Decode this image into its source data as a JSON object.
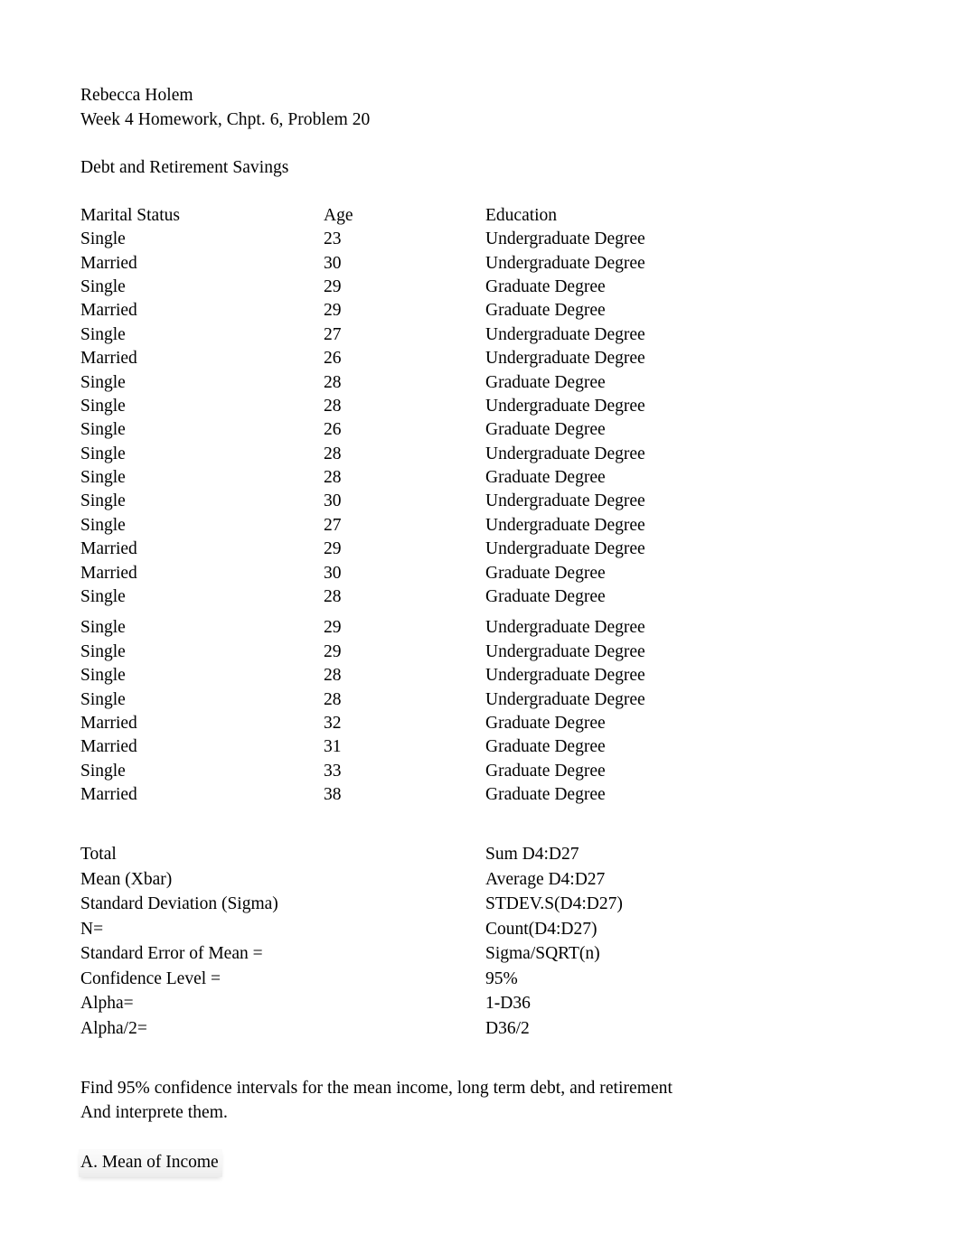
{
  "document": {
    "author": "Rebecca Holem",
    "assignment": "Week 4 Homework, Chpt. 6, Problem 20",
    "subject_title": "Debt and Retirement Savings"
  },
  "table": {
    "headers": {
      "marital_status": "Marital Status",
      "age": "Age",
      "education": "Education"
    },
    "rows": [
      {
        "marital_status": "Single",
        "age": "23",
        "education": "Undergraduate Degree"
      },
      {
        "marital_status": "Married",
        "age": "30",
        "education": "Undergraduate Degree"
      },
      {
        "marital_status": "Single",
        "age": "29",
        "education": "Graduate Degree"
      },
      {
        "marital_status": "Married",
        "age": "29",
        "education": "Graduate Degree"
      },
      {
        "marital_status": "Single",
        "age": "27",
        "education": "Undergraduate Degree"
      },
      {
        "marital_status": "Married",
        "age": "26",
        "education": "Undergraduate Degree"
      },
      {
        "marital_status": "Single",
        "age": "28",
        "education": "Graduate Degree"
      },
      {
        "marital_status": "Single",
        "age": "28",
        "education": "Undergraduate Degree"
      },
      {
        "marital_status": "Single",
        "age": "26",
        "education": "Graduate Degree"
      },
      {
        "marital_status": "Single",
        "age": "28",
        "education": "Undergraduate Degree"
      },
      {
        "marital_status": "Single",
        "age": "28",
        "education": "Graduate Degree"
      },
      {
        "marital_status": "Single",
        "age": "30",
        "education": "Undergraduate Degree"
      },
      {
        "marital_status": "Single",
        "age": "27",
        "education": "Undergraduate Degree"
      },
      {
        "marital_status": "Married",
        "age": "29",
        "education": "Undergraduate Degree"
      },
      {
        "marital_status": "Married",
        "age": "30",
        "education": "Graduate Degree"
      },
      {
        "marital_status": "Single",
        "age": "28",
        "education": "Graduate Degree"
      },
      {
        "marital_status": "Single",
        "age": "29",
        "education": "Undergraduate Degree"
      },
      {
        "marital_status": "Single",
        "age": "29",
        "education": "Undergraduate Degree"
      },
      {
        "marital_status": "Single",
        "age": "28",
        "education": "Undergraduate Degree"
      },
      {
        "marital_status": "Single",
        "age": "28",
        "education": "Undergraduate Degree"
      },
      {
        "marital_status": "Married",
        "age": "32",
        "education": "Graduate Degree"
      },
      {
        "marital_status": "Married",
        "age": "31",
        "education": "Graduate Degree"
      },
      {
        "marital_status": "Single",
        "age": "33",
        "education": "Graduate Degree"
      },
      {
        "marital_status": "Married",
        "age": "38",
        "education": "Graduate Degree"
      }
    ]
  },
  "statistics": [
    {
      "label": "Total",
      "value": "Sum D4:D27"
    },
    {
      "label": "Mean (Xbar)",
      "value": "Average D4:D27"
    },
    {
      "label": "Standard Deviation (Sigma)",
      "value": "STDEV.S(D4:D27)"
    },
    {
      "label": "N=",
      "value": "Count(D4:D27)"
    },
    {
      "label": "Standard Error of Mean =",
      "value": "Sigma/SQRT(n)"
    },
    {
      "label": "Confidence Level =",
      "value": "95%"
    },
    {
      "label": "Alpha=",
      "value": "1-D36"
    },
    {
      "label": "Alpha/2=",
      "value": "D36/2"
    }
  ],
  "instructions": {
    "line1": "Find 95% confidence intervals for the mean income, long term debt, and retirement",
    "line2": "And interprete them."
  },
  "sections": {
    "part_a": "A. Mean of Income"
  }
}
